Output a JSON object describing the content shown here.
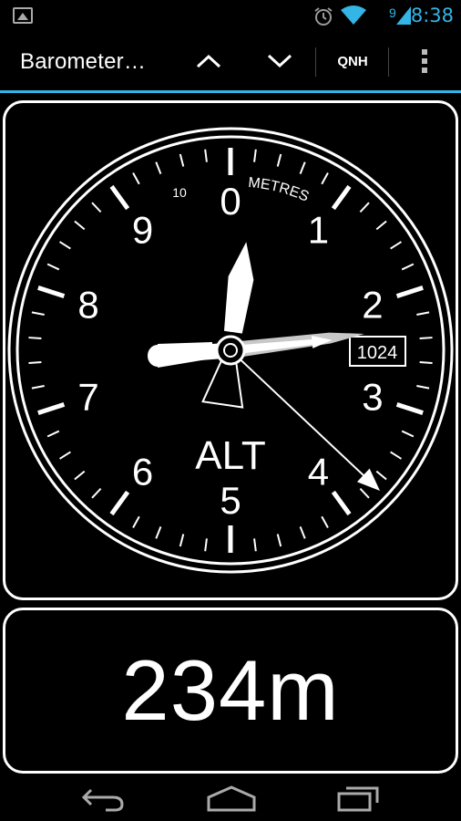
{
  "status_bar": {
    "time": "8:38",
    "signal_badge": "9",
    "icons": [
      "image-notification-icon",
      "alarm-icon",
      "wifi-icon",
      "cell-signal-icon"
    ]
  },
  "action_bar": {
    "title": "Barometer…",
    "up_icon": "chevron-up-icon",
    "down_icon": "chevron-down-icon",
    "qnh_label": "QNH",
    "menu_icon": "overflow-menu-icon"
  },
  "gauge": {
    "dial_numbers": [
      "0",
      "1",
      "2",
      "3",
      "4",
      "5",
      "6",
      "7",
      "8",
      "9"
    ],
    "units_label": "METRES",
    "tens_label": "10",
    "center_label": "ALT",
    "qnh_window": "1024",
    "hands": {
      "long_hand_dial_value": 2.34,
      "short_hand_dial_value": 0.23,
      "ten_thousands_pointer_dial_value": 3.7
    }
  },
  "readout": {
    "value": "234m"
  },
  "nav_bar": {
    "back_icon": "back-icon",
    "home_icon": "home-icon",
    "recents_icon": "recent-apps-icon"
  },
  "colors": {
    "accent": "#33b5e5",
    "background": "#000000",
    "foreground": "#ffffff",
    "qnh_hand": "#c8c8c8"
  }
}
